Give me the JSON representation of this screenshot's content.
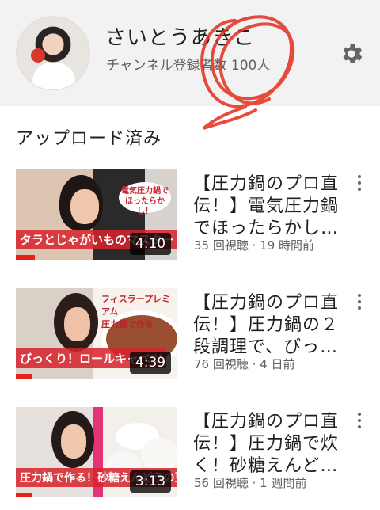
{
  "channel": {
    "title": "さいとうあきこ",
    "subscribers": "チャンネル登録者数 100人"
  },
  "section": {
    "title": "アップロード済み"
  },
  "videos": [
    {
      "title": "【圧力鍋のプロ直伝！】電気圧力鍋でほったらかし…",
      "meta": "35 回視聴 · 19 時間前",
      "duration": "4:10",
      "caption": "タラとじゃがいものマスタード煮",
      "progress": 0.12
    },
    {
      "title": "【圧力鍋のプロ直伝！】圧力鍋の２段調理で、びっ…",
      "meta": "76 回視聴 · 4 日前",
      "duration": "4:39",
      "caption": "びっくり！ロールキャベツ",
      "progress": 0.1
    },
    {
      "title": "【圧力鍋のプロ直伝！】圧力鍋で炊く！砂糖えんど…",
      "meta": "56 回視聴 · 1 週間前",
      "duration": "3:13",
      "caption": "圧力鍋で作る！砂糖えんどうの豆ごはん",
      "progress": 0.1
    }
  ],
  "colors": {
    "accent": "#e62117",
    "header_bg": "#f2f2f2",
    "annotation": "#e2301f"
  },
  "icons": {
    "settings": "gear-icon",
    "menu": "more-vertical-icon"
  }
}
